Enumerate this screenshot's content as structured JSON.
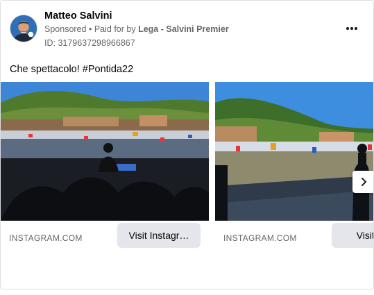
{
  "post": {
    "author": "Matteo Salvini",
    "sponsored": "Sponsored",
    "separator": "•",
    "paid_prefix": "Paid for by",
    "paid_by": "Lega - Salvini Premier",
    "ad_id": "ID: 3179637298966867",
    "text": "Che spettacolo! #Pontida22"
  },
  "carousel": {
    "cards": [
      {
        "domain": "INSTAGRAM.COM",
        "cta_label": "Visit Instagr…"
      },
      {
        "domain": "INSTAGRAM.COM",
        "cta_label": "Visit Ins"
      }
    ]
  },
  "icons": {
    "more": "more-horizontal-icon",
    "next": "chevron-right-icon"
  },
  "colors": {
    "secondary_text": "#65676b",
    "button_bg": "#e4e6eb",
    "border": "#dddfe2"
  }
}
